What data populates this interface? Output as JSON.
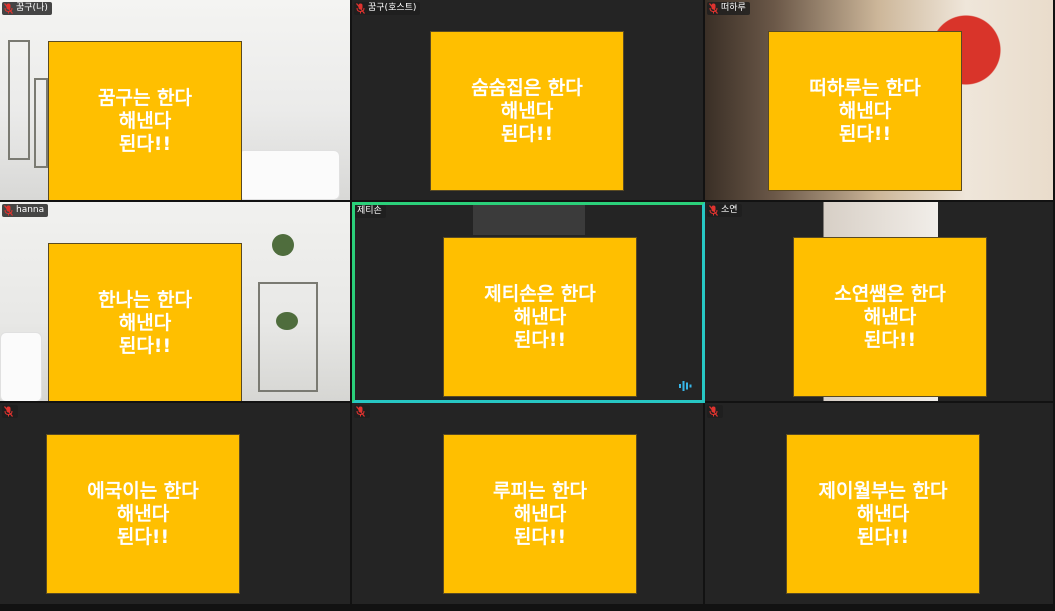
{
  "participants": [
    {
      "name": "꿈구(나)",
      "card_lines": [
        "꿈구는 한다",
        "해낸다",
        "된다!!"
      ],
      "muted": true,
      "background": "room"
    },
    {
      "name": "꿈구(호스트)",
      "card_lines": [
        "숨숨집은 한다",
        "해낸다",
        "된다!!"
      ],
      "muted": true,
      "background": "dark"
    },
    {
      "name": "떠하루",
      "card_lines": [
        "떠하루는 한다",
        "해낸다",
        "된다!!"
      ],
      "muted": true,
      "background": "warm"
    },
    {
      "name": "hanna",
      "card_lines": [
        "한나는 한다",
        "해낸다",
        "된다!!"
      ],
      "muted": true,
      "background": "room"
    },
    {
      "name": "제티손",
      "card_lines": [
        "제티손은 한다",
        "해낸다",
        "된다!!"
      ],
      "muted": false,
      "speaking": true,
      "background": "dark"
    },
    {
      "name": "소연",
      "card_lines": [
        "소연쌤은 한다",
        "해낸다",
        "된다!!"
      ],
      "muted": true,
      "background": "face"
    },
    {
      "name": "",
      "card_lines": [
        "에국이는 한다",
        "해낸다",
        "된다!!"
      ],
      "muted": true,
      "background": "dark"
    },
    {
      "name": "",
      "card_lines": [
        "루피는 한다",
        "해낸다",
        "된다!!"
      ],
      "muted": true,
      "background": "dark"
    },
    {
      "name": "",
      "card_lines": [
        "제이월부는 한다",
        "해낸다",
        "된다!!"
      ],
      "muted": true,
      "background": "dark"
    }
  ],
  "colors": {
    "card": "#ffbf00",
    "card_text": "#ffffff",
    "muted_mic": "#e0332f",
    "active_speaker_border": "#2bd07a",
    "tile_background": "#242424"
  },
  "icons": {
    "muted": "mic-muted-icon",
    "speaking": "audio-level-icon"
  }
}
